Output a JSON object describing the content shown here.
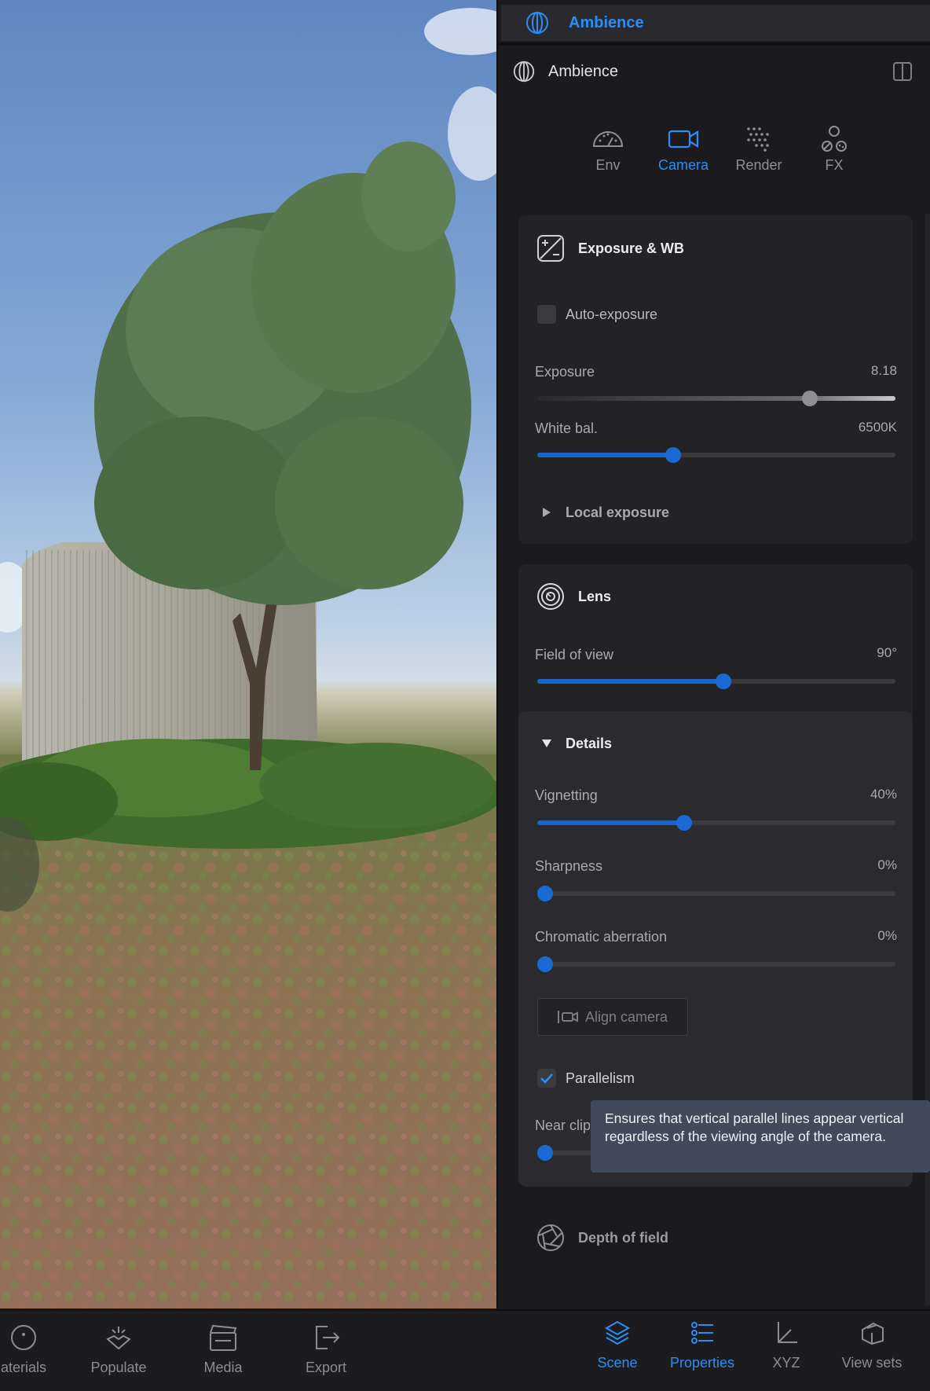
{
  "topbar": {
    "title": "Ambience"
  },
  "panel_header": {
    "title": "Ambience"
  },
  "tabs": [
    {
      "label": "Env",
      "active": false
    },
    {
      "label": "Camera",
      "active": true
    },
    {
      "label": "Render",
      "active": false
    },
    {
      "label": "FX",
      "active": false
    }
  ],
  "exposure_section": {
    "title": "Exposure & WB",
    "auto_exposure": {
      "label": "Auto-exposure",
      "checked": false
    },
    "exposure": {
      "label": "Exposure",
      "value": "8.18",
      "fraction": 0.76
    },
    "white_balance": {
      "label": "White bal.",
      "value": "6500K",
      "fraction": 0.38
    },
    "local_exposure": {
      "label": "Local exposure"
    }
  },
  "lens_section": {
    "title": "Lens",
    "field_of_view": {
      "label": "Field of view",
      "value": "90°",
      "fraction": 0.52
    },
    "details": {
      "title": "Details",
      "vignetting": {
        "label": "Vignetting",
        "value": "40%",
        "fraction": 0.41
      },
      "sharpness": {
        "label": "Sharpness",
        "value": "0%",
        "fraction": 0.0
      },
      "chromatic_aberration": {
        "label": "Chromatic aberration",
        "value": "0%",
        "fraction": 0.0
      },
      "align_camera": {
        "label": "Align camera"
      },
      "parallelism": {
        "label": "Parallelism",
        "checked": true
      },
      "near_clip": {
        "label": "Near clip",
        "fraction": 0.01
      }
    }
  },
  "tooltip": {
    "text": "Ensures that vertical parallel lines appear vertical regardless of the viewing angle of the camera."
  },
  "dof_section": {
    "title": "Depth of field"
  },
  "bottom_nav": {
    "left": [
      {
        "label": "aterials"
      },
      {
        "label": "Populate"
      },
      {
        "label": "Media"
      },
      {
        "label": "Export"
      }
    ],
    "right": [
      {
        "label": "Scene",
        "active": true
      },
      {
        "label": "Properties",
        "active": true
      },
      {
        "label": "XYZ",
        "active": false
      },
      {
        "label": "View sets",
        "active": false
      }
    ]
  },
  "colors": {
    "accent": "#2b8ef6",
    "panel_bg": "#1b1b1e",
    "card_bg": "#232326",
    "tooltip_bg": "#414a5b"
  }
}
